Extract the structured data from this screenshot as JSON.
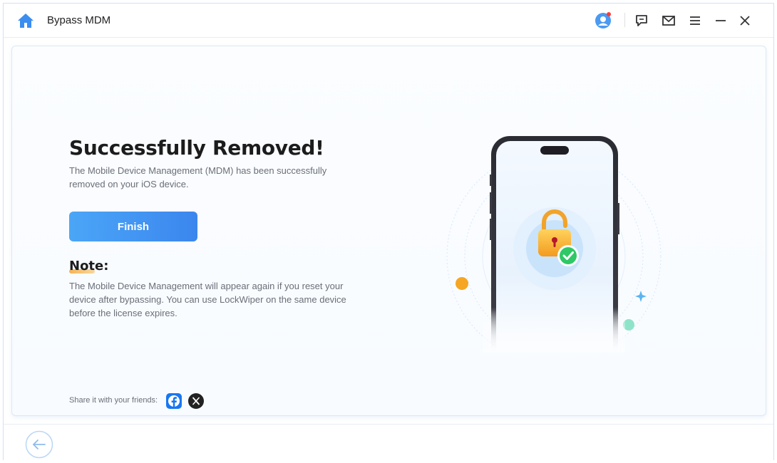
{
  "app": {
    "title": "Bypass MDM"
  },
  "titlebar": {
    "icons": [
      "home-icon",
      "user-avatar-icon",
      "feedback-icon",
      "mail-icon",
      "menu-icon",
      "minimize-icon",
      "close-icon"
    ],
    "notification_dot_color": "#ff3b30"
  },
  "main": {
    "headline": "Successfully Removed!",
    "description": "The Mobile Device Management (MDM) has been successfully removed on your iOS device.",
    "finish_label": "Finish",
    "note_title": "Note:",
    "note_text": "The Mobile Device Management will appear again if you reset your device after bypassing. You can use LockWiper on the same device before the license expires.",
    "share_label": "Share it with your friends:"
  },
  "illustration": {
    "icons": [
      "unlocked-padlock-icon",
      "check-badge-icon"
    ]
  },
  "colors": {
    "accent": "#3b8df0",
    "check_green": "#2ec866",
    "lock_gold": "#f4b73c"
  }
}
